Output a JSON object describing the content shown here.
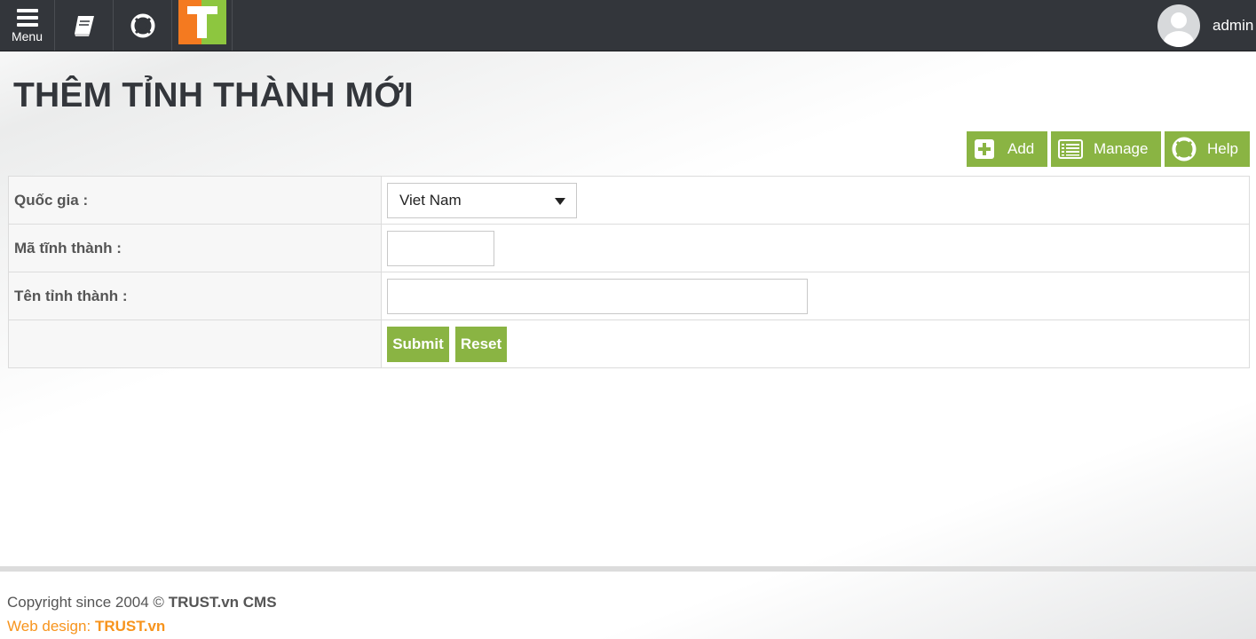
{
  "topbar": {
    "menu_label": "Menu",
    "book_icon": "book-icon",
    "help_icon": "lifebuoy-icon",
    "logo_text": "T",
    "user_name": "admin"
  },
  "page": {
    "title": "THÊM TỈNH THÀNH MỚI"
  },
  "actions": {
    "add": "Add",
    "manage": "Manage",
    "help": "Help"
  },
  "form": {
    "country_label": "Quốc gia :",
    "country_value": "Viet Nam",
    "code_label": "Mã tĩnh thành :",
    "code_value": "",
    "name_label": "Tên tỉnh thành :",
    "name_value": "",
    "submit": "Submit",
    "reset": "Reset"
  },
  "footer": {
    "copyright_prefix": "Copyright since 2004 ©",
    "copyright_brand": "TRUST.vn CMS",
    "design_prefix": "Web design:",
    "design_brand": "TRUST.vn"
  },
  "colors": {
    "topbar": "#33363b",
    "accent_green": "#8ab443",
    "footer_orange": "#f7941d",
    "logo_orange": "#f47a20",
    "logo_green": "#8dc63f"
  }
}
